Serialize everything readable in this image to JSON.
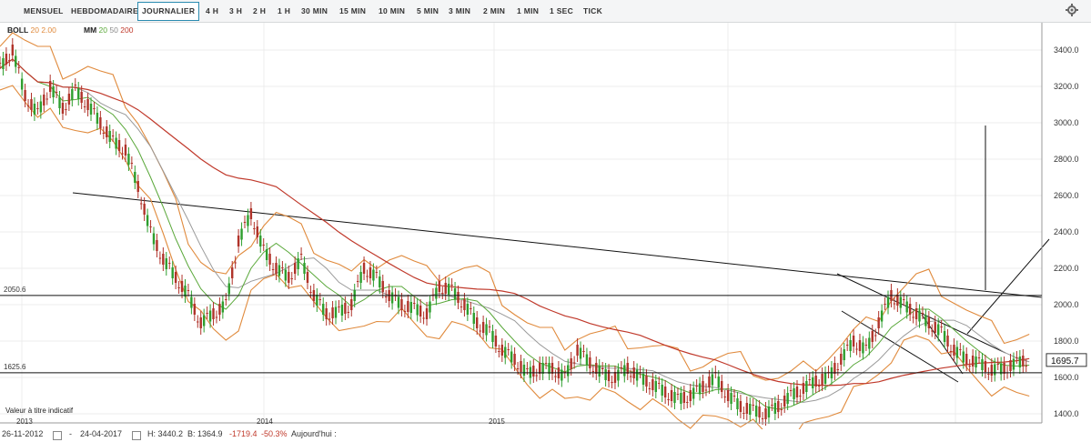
{
  "toolbar": {
    "tabs": [
      "MENSUEL",
      "HEBDOMADAIRE",
      "JOURNALIER",
      "4 H",
      "3 H",
      "2 H",
      "1 H",
      "30 MIN",
      "15 MIN",
      "10 MIN",
      "5 MIN",
      "3 MIN",
      "2 MIN",
      "1 MIN",
      "1 SEC",
      "TICK"
    ],
    "active": "JOURNALIER",
    "settings_icon": "gear-icon"
  },
  "legend": {
    "boll_label": "BOLL",
    "boll_params": "20 2.00",
    "mm_label": "MM",
    "mm_20": "20",
    "mm_50": "50",
    "mm_200": "200"
  },
  "disclaimer": "Valeur à titre indicatif",
  "footer": {
    "start": "26-11-2012",
    "end": "24-04-2017",
    "high": "H: 3440.2",
    "low": "B: 1364.9",
    "change": "-1719.4",
    "change_pct": "-50.3%",
    "today": "Aujourd'hui :"
  },
  "colors": {
    "up": "#2e9e2e",
    "down": "#b0332a",
    "boll": "#e08a3c",
    "ma20": "#5aa83a",
    "ma50": "#9a9a9a",
    "ma200": "#c0392b",
    "last_price_bg": "#ffffff"
  },
  "chart_data": {
    "type": "candlestick",
    "y_ticks": [
      1400,
      1600,
      1800,
      2000,
      2200,
      2400,
      2600,
      2800,
      3000,
      3200,
      3400
    ],
    "y_tick_labels": [
      "1400.0",
      "1600.0",
      "1800.0",
      "2000.0",
      "2200.0",
      "2400.0",
      "2600.0",
      "2800.0",
      "3000.0",
      "3200.0",
      "3400.0"
    ],
    "x_tick_labels": [
      "2013",
      "2014",
      "2015"
    ],
    "horizontal_levels": [
      {
        "label": "2050.6",
        "value": 2050.6
      },
      {
        "label": "1625.6",
        "value": 1625.6
      }
    ],
    "last_price": "1695.7",
    "series_close": [
      [
        0,
        3300
      ],
      [
        2,
        3400
      ],
      [
        4,
        3150
      ],
      [
        6,
        3050
      ],
      [
        8,
        3200
      ],
      [
        10,
        3080
      ],
      [
        12,
        3180
      ],
      [
        14,
        3100
      ],
      [
        16,
        3000
      ],
      [
        18,
        2900
      ],
      [
        20,
        2850
      ],
      [
        22,
        2650
      ],
      [
        24,
        2400
      ],
      [
        26,
        2250
      ],
      [
        28,
        2150
      ],
      [
        30,
        2050
      ],
      [
        32,
        1900
      ],
      [
        34,
        1950
      ],
      [
        36,
        2000
      ],
      [
        38,
        2350
      ],
      [
        40,
        2500
      ],
      [
        42,
        2300
      ],
      [
        44,
        2200
      ],
      [
        46,
        2150
      ],
      [
        48,
        2250
      ],
      [
        50,
        2050
      ],
      [
        52,
        1950
      ],
      [
        54,
        1960
      ],
      [
        56,
        2000
      ],
      [
        58,
        2200
      ],
      [
        60,
        2150
      ],
      [
        62,
        2050
      ],
      [
        64,
        2000
      ],
      [
        66,
        1980
      ],
      [
        68,
        1950
      ],
      [
        70,
        2100
      ],
      [
        72,
        2080
      ],
      [
        74,
        2000
      ],
      [
        76,
        1900
      ],
      [
        78,
        1850
      ],
      [
        80,
        1750
      ],
      [
        82,
        1700
      ],
      [
        84,
        1620
      ],
      [
        86,
        1650
      ],
      [
        88,
        1650
      ],
      [
        90,
        1600
      ],
      [
        92,
        1750
      ],
      [
        94,
        1680
      ],
      [
        96,
        1620
      ],
      [
        98,
        1600
      ],
      [
        100,
        1650
      ],
      [
        102,
        1600
      ],
      [
        104,
        1560
      ],
      [
        106,
        1520
      ],
      [
        108,
        1480
      ],
      [
        110,
        1500
      ],
      [
        112,
        1550
      ],
      [
        114,
        1600
      ],
      [
        116,
        1500
      ],
      [
        118,
        1440
      ],
      [
        120,
        1420
      ],
      [
        122,
        1400
      ],
      [
        124,
        1440
      ],
      [
        126,
        1500
      ],
      [
        128,
        1540
      ],
      [
        130,
        1580
      ],
      [
        132,
        1600
      ],
      [
        134,
        1700
      ],
      [
        136,
        1800
      ],
      [
        138,
        1750
      ],
      [
        140,
        1900
      ],
      [
        142,
        2050
      ],
      [
        144,
        2000
      ],
      [
        146,
        1950
      ],
      [
        148,
        1900
      ],
      [
        150,
        1850
      ],
      [
        152,
        1750
      ],
      [
        154,
        1700
      ],
      [
        156,
        1680
      ],
      [
        158,
        1640
      ],
      [
        160,
        1650
      ],
      [
        162,
        1680
      ],
      [
        164,
        1700
      ]
    ],
    "x_domain": [
      0,
      166
    ],
    "y_domain": [
      1350,
      3550
    ]
  }
}
